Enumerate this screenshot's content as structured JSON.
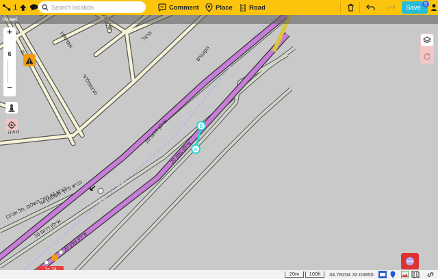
{
  "toolbar": {
    "segment_count": "1",
    "search_placeholder": "Search location",
    "comment_label": "Comment",
    "place_label": "Place",
    "road_label": "Road",
    "save_label": "Save",
    "save_badge": "5"
  },
  "country": "Israel",
  "map": {
    "zoom_level": "6",
    "streets": {
      "s1": "רמבם",
      "s2": "אוסישקין",
      "s3": "תרומפלדור",
      "s4": "נחלה",
      "s5": "שלומציון",
      "s6": "הרצל"
    },
    "highway_labels": {
      "h1": "20 איילון דרום",
      "h2": "20 איילון צפון",
      "h3": "20 איילון דרום",
      "h4": "20 איילון צפון"
    },
    "other_labels": {
      "rail": "44 כביש (דרך השלום)",
      "road2": "כביש 44 (פר' השלום ,תל אביב)",
      "road3": "הקונגרס"
    },
    "node_a": "A",
    "node_b": "B",
    "shield": "1c 74"
  },
  "bottom": {
    "scale_metric": "20m",
    "scale_imperial": "100ft",
    "coordinates": "34.78204 32.03850"
  },
  "colors": {
    "toolbar": "#fcc40c",
    "highway": "#c77dd8",
    "street": "#f6f2d6",
    "ramp": "#cfd6c9",
    "selected": "#2bd2d7",
    "save": "#26bcd9"
  }
}
